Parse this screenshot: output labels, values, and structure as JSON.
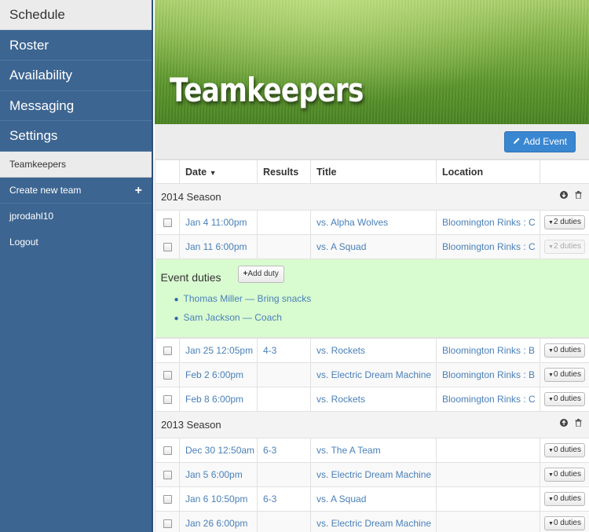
{
  "sidebar": {
    "nav": [
      "Schedule",
      "Roster",
      "Availability",
      "Messaging",
      "Settings"
    ],
    "active_index": 0,
    "team_name": "Teamkeepers",
    "create_team": "Create new team",
    "username": "jprodahl10",
    "logout": "Logout"
  },
  "banner": {
    "title": "Teamkeepers"
  },
  "toolbar": {
    "add_event": "Add Event"
  },
  "table": {
    "headers": {
      "date": "Date",
      "results": "Results",
      "title": "Title",
      "location": "Location"
    },
    "seasons": [
      {
        "name": "2014 Season",
        "rows": [
          {
            "date": "Jan 4 11:00pm",
            "results": "",
            "title": "vs. Alpha Wolves",
            "location": "Bloomington Rinks : C",
            "duties": "2 duties"
          },
          {
            "date": "Jan 11 6:00pm",
            "results": "",
            "title": "vs. A Squad",
            "location": "Bloomington Rinks : C",
            "duties": "2 duties"
          },
          {
            "date": "Jan 25 12:05pm",
            "results": "4-3",
            "title": "vs. Rockets",
            "location": "Bloomington Rinks : B",
            "duties": "0 duties"
          },
          {
            "date": "Feb 2 6:00pm",
            "results": "",
            "title": "vs. Electric Dream Machine",
            "location": "Bloomington Rinks : B",
            "duties": "0 duties"
          },
          {
            "date": "Feb 8 6:00pm",
            "results": "",
            "title": "vs. Rockets",
            "location": "Bloomington Rinks : C",
            "duties": "0 duties"
          }
        ]
      },
      {
        "name": "2013 Season",
        "rows": [
          {
            "date": "Dec 30 12:50am",
            "results": "6-3",
            "title": "vs. The A Team",
            "location": "",
            "duties": "0 duties"
          },
          {
            "date": "Jan 5 6:00pm",
            "results": "",
            "title": "vs. Electric Dream Machine",
            "location": "",
            "duties": "0 duties"
          },
          {
            "date": "Jan 6 10:50pm",
            "results": "6-3",
            "title": "vs. A Squad",
            "location": "",
            "duties": "0 duties"
          },
          {
            "date": "Jan 26 6:00pm",
            "results": "",
            "title": "vs. Electric Dream Machine",
            "location": "",
            "duties": "0 duties"
          }
        ]
      }
    ]
  },
  "duties_panel": {
    "title": "Event duties",
    "add_duty": "Add duty",
    "items": [
      "Thomas Miller — Bring snacks",
      "Sam Jackson — Coach"
    ]
  },
  "colors": {
    "sidebar": "#3d6591",
    "accent": "#3a87d1",
    "link": "#4a80b8",
    "duties_bg": "#d9fbd0"
  },
  "icons": {
    "sort": "caret-down-icon",
    "add_event": "pencil-icon",
    "create_team": "plus-icon",
    "season_2014": [
      "circle-arrow-down-icon",
      "trash-icon"
    ],
    "season_2013": [
      "circle-arrow-up-icon",
      "trash-icon"
    ]
  }
}
